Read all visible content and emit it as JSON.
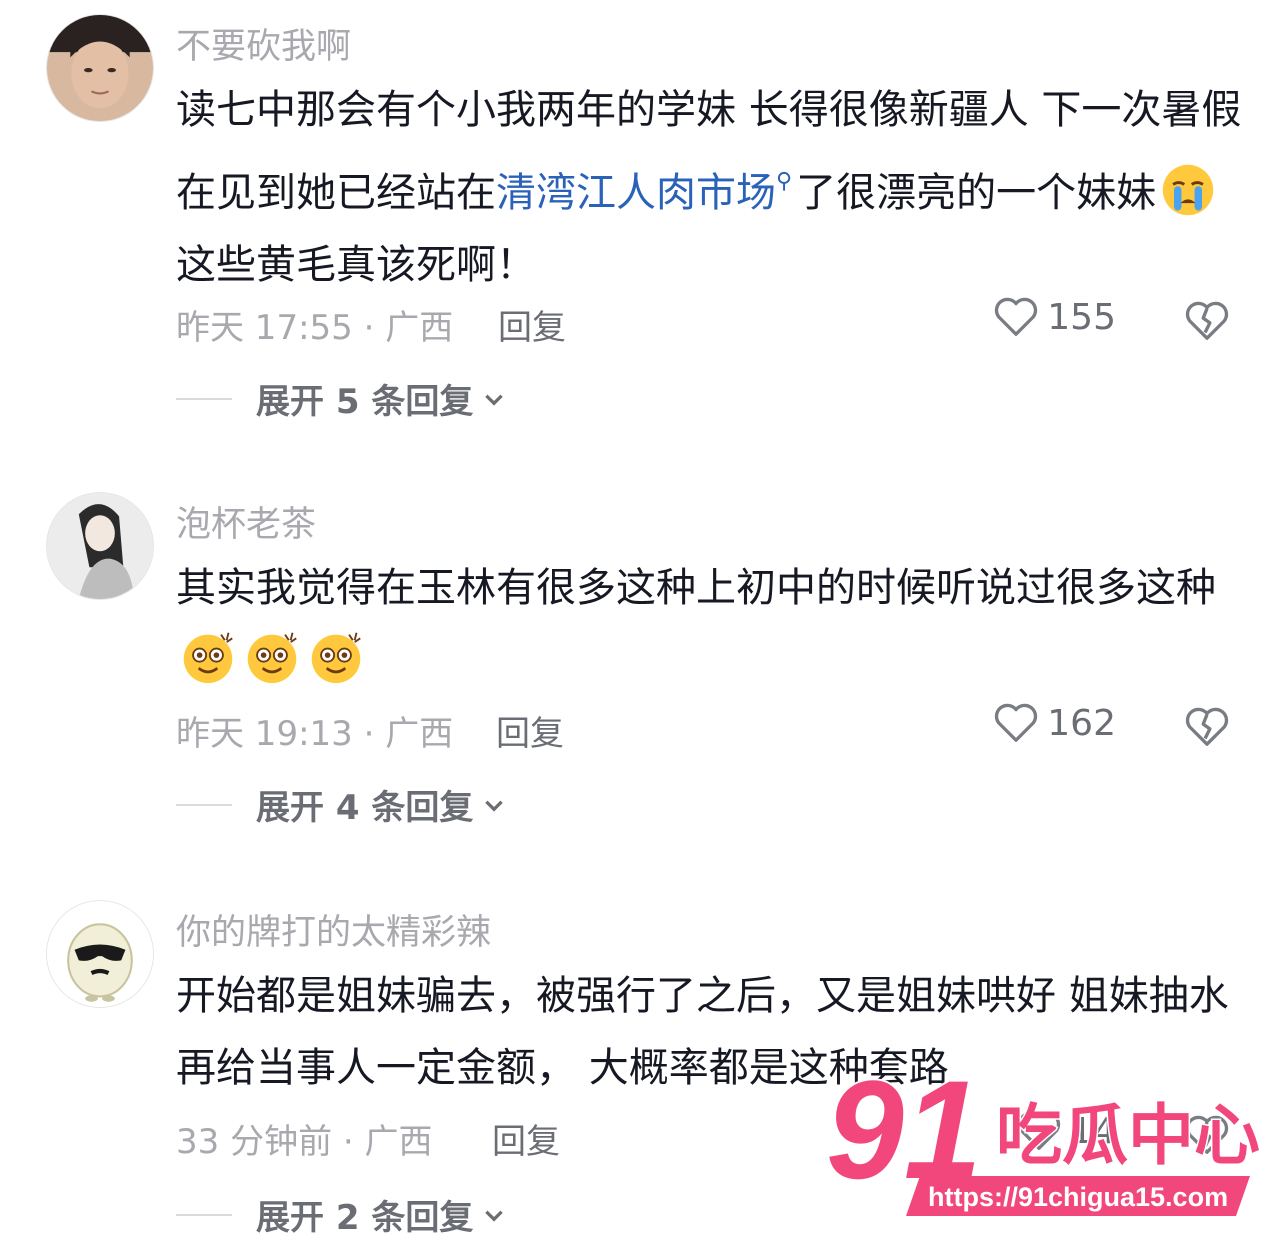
{
  "comments": [
    {
      "username": "不要砍我啊",
      "text_before": "读七中那会有个小我两年的学妹  长得很像新疆人    下一次暑假在见到她已经站在",
      "link": "清湾江人肉市场",
      "text_after": "了很漂亮的一个妹妹",
      "text_end": "   这些黄毛真该死啊！",
      "time_location": "昨天 17:55 · 广西",
      "reply_label": "回复",
      "likes": "155",
      "expand_label": "展开 5 条回复"
    },
    {
      "username": "泡杯老茶",
      "text": "其实我觉得在玉林有很多这种上初中的时候听说过很多这种",
      "time_location": "昨天 19:13 · 广西",
      "reply_label": "回复",
      "likes": "162",
      "expand_label": "展开 4 条回复"
    },
    {
      "username": "你的牌打的太精彩辣",
      "text": "开始都是姐妹骗去，被强行了之后，又是姐妹哄好 姐妹抽水 再给当事人一定金额， 大概率都是这种套路",
      "time_location": "33 分钟前 · 广西",
      "reply_label": "回复",
      "likes": "14",
      "expand_label": "展开 2 条回复"
    }
  ],
  "watermark": {
    "number": "91",
    "brand": "吃瓜中心",
    "url": "https://91chigua15.com",
    "color": "#f2477d"
  }
}
